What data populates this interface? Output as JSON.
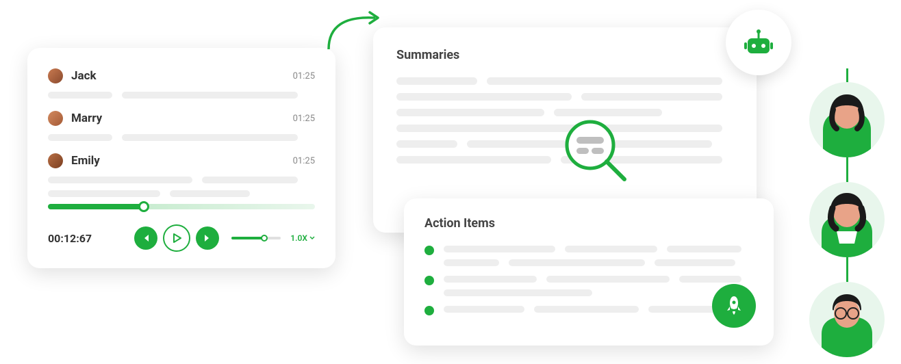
{
  "colors": {
    "accent": "#1eae3e",
    "skeleton": "#eeeeee"
  },
  "transcript": {
    "speakers": [
      {
        "name": "Jack",
        "time": "01:25",
        "avatar_bg": "#c97a50"
      },
      {
        "name": "Marry",
        "time": "01:25",
        "avatar_bg": "#d28a60"
      },
      {
        "name": "Emily",
        "time": "01:25",
        "avatar_bg": "#b86f45"
      }
    ],
    "player": {
      "current_time": "00:12:67",
      "speed": "1.0X",
      "progress_percent": 36,
      "volume_percent": 66
    }
  },
  "summaries": {
    "title": "Summaries"
  },
  "action_items": {
    "title": "Action Items",
    "bullet_count": 3
  },
  "icons": {
    "bot": "bot-icon",
    "rocket": "rocket-icon",
    "magnifier": "magnifier-icon",
    "prev": "skip-prev-icon",
    "play": "play-icon",
    "next": "skip-next-icon",
    "chevron_down": "chevron-down-icon"
  },
  "avatars": [
    {
      "id": "user-1"
    },
    {
      "id": "user-2"
    },
    {
      "id": "user-3"
    }
  ]
}
